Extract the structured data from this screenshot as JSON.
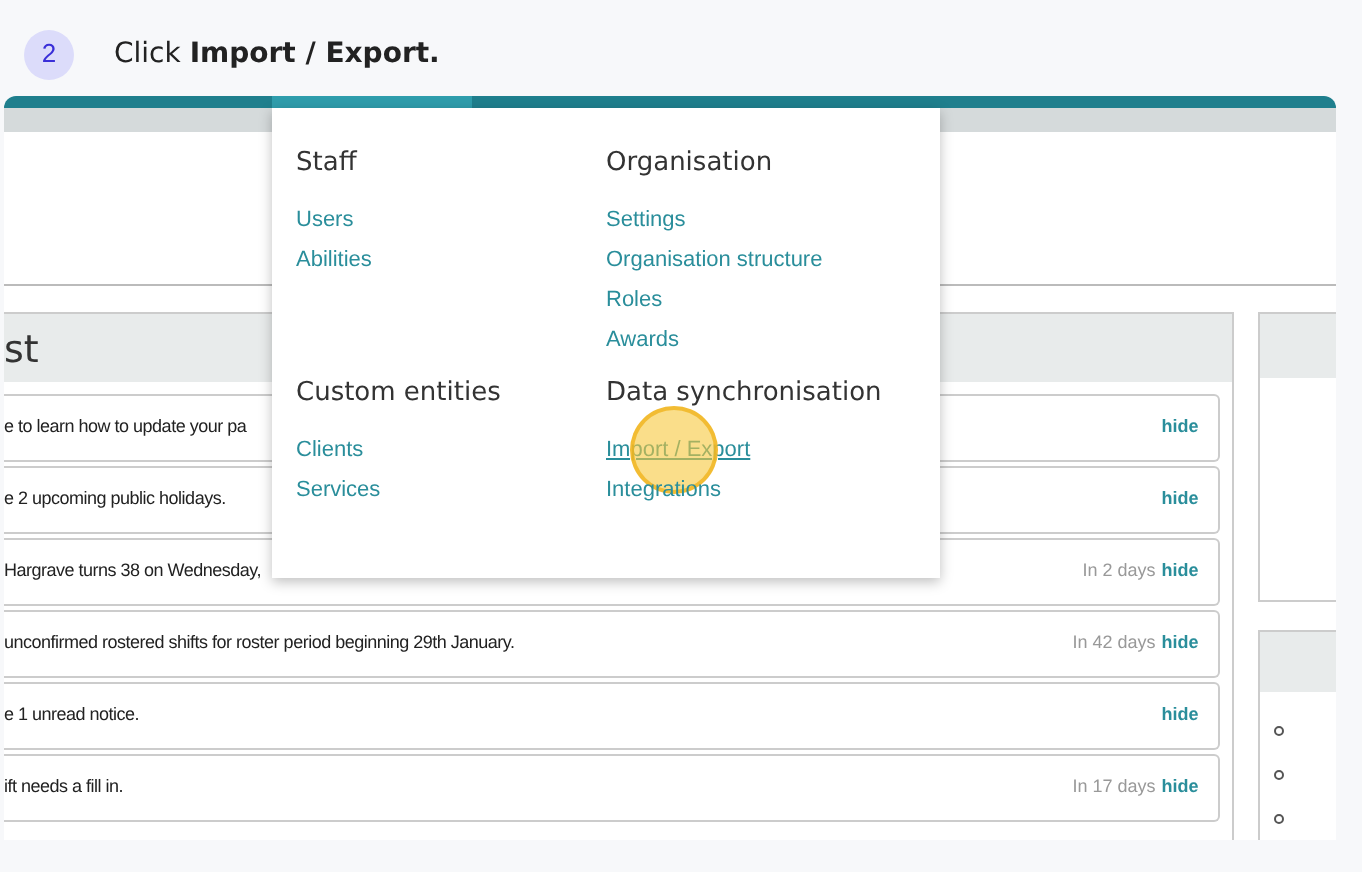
{
  "step": {
    "number": "2",
    "text": "Click **Import / Export.**"
  },
  "menu": {
    "sections": [
      {
        "heading": "Staff",
        "links": [
          {
            "label": "Users",
            "selected": false
          },
          {
            "label": "Abilities",
            "selected": false
          }
        ]
      },
      {
        "heading": "Organisation",
        "links": [
          {
            "label": "Settings",
            "selected": false
          },
          {
            "label": "Organisation structure",
            "selected": false
          },
          {
            "label": "Roles",
            "selected": false
          },
          {
            "label": "Awards",
            "selected": false
          }
        ]
      },
      {
        "heading": "Custom entities",
        "links": [
          {
            "label": "Clients",
            "selected": false
          },
          {
            "label": "Services",
            "selected": false
          }
        ]
      },
      {
        "heading": "Data synchronisation",
        "links": [
          {
            "label": "Import / Export",
            "selected": true
          },
          {
            "label": "Integrations",
            "selected": false
          }
        ]
      }
    ]
  },
  "panel": {
    "title": "st",
    "items": [
      {
        "text": "e to learn how to update your pa",
        "action": "hide"
      },
      {
        "text": "e 2 upcoming public holidays.",
        "action": "hide"
      },
      {
        "text": "Hargrave turns 38 on Wednesday,",
        "due": "In 2 days",
        "action": "hide"
      },
      {
        "text": "unconfirmed rostered shifts for roster period beginning 29th January.",
        "due": "In 42 days",
        "action": "hide"
      },
      {
        "text": "e 1 unread notice.",
        "action": "hide"
      },
      {
        "text": "ift needs a fill in.",
        "due": "In 17 days",
        "action": "hide"
      }
    ]
  }
}
